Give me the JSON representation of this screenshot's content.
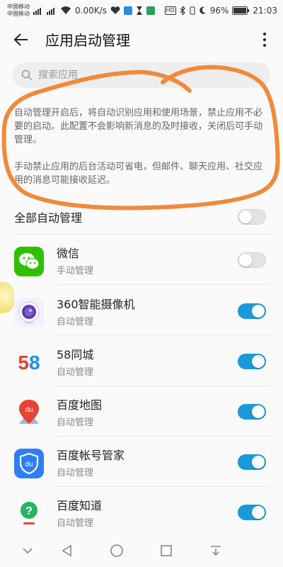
{
  "status_bar": {
    "carrier1": "中国移动",
    "carrier2": "中国移动",
    "net1": "2G",
    "net2": "4G",
    "speed": "0.00K/s",
    "hd": "HD",
    "battery": "96%",
    "time": "21:03"
  },
  "header": {
    "title": "应用启动管理"
  },
  "search": {
    "placeholder": "搜索应用"
  },
  "description": {
    "para1": "自动管理开启后，将自动识别应用和使用场景，禁止应用不必要的启动。此配置不会影响新消息的及时接收，关闭后可手动管理。",
    "para2": "手动禁止应用的后台活动可省电，但邮件、聊天应用、社交应用的消息可能接收延迟。"
  },
  "master": {
    "label": "全部自动管理",
    "enabled": false
  },
  "apps": [
    {
      "name": "微信",
      "mode": "手动管理",
      "enabled": false,
      "icon": "wechat-icon"
    },
    {
      "name": "360智能摄像机",
      "mode": "自动管理",
      "enabled": true,
      "icon": "camera-360-icon"
    },
    {
      "name": "58同城",
      "mode": "自动管理",
      "enabled": true,
      "icon": "58-logo-icon"
    },
    {
      "name": "百度地图",
      "mode": "自动管理",
      "enabled": true,
      "icon": "baidu-map-icon"
    },
    {
      "name": "百度帐号管家",
      "mode": "自动管理",
      "enabled": true,
      "icon": "baidu-account-icon"
    },
    {
      "name": "百度知道",
      "mode": "自动管理",
      "enabled": true,
      "icon": "baidu-zhidao-icon"
    }
  ],
  "icons": {
    "58_five": "5",
    "58_eight": "8",
    "baidu_map_text": "du",
    "baidu_account_text": "du",
    "zhidao_text": "?"
  },
  "colors": {
    "toggle_on": "#1a9ad8",
    "toggle_off": "#e3e3e3",
    "annotation": "#f08a3a",
    "wechat": "#2dc100"
  }
}
